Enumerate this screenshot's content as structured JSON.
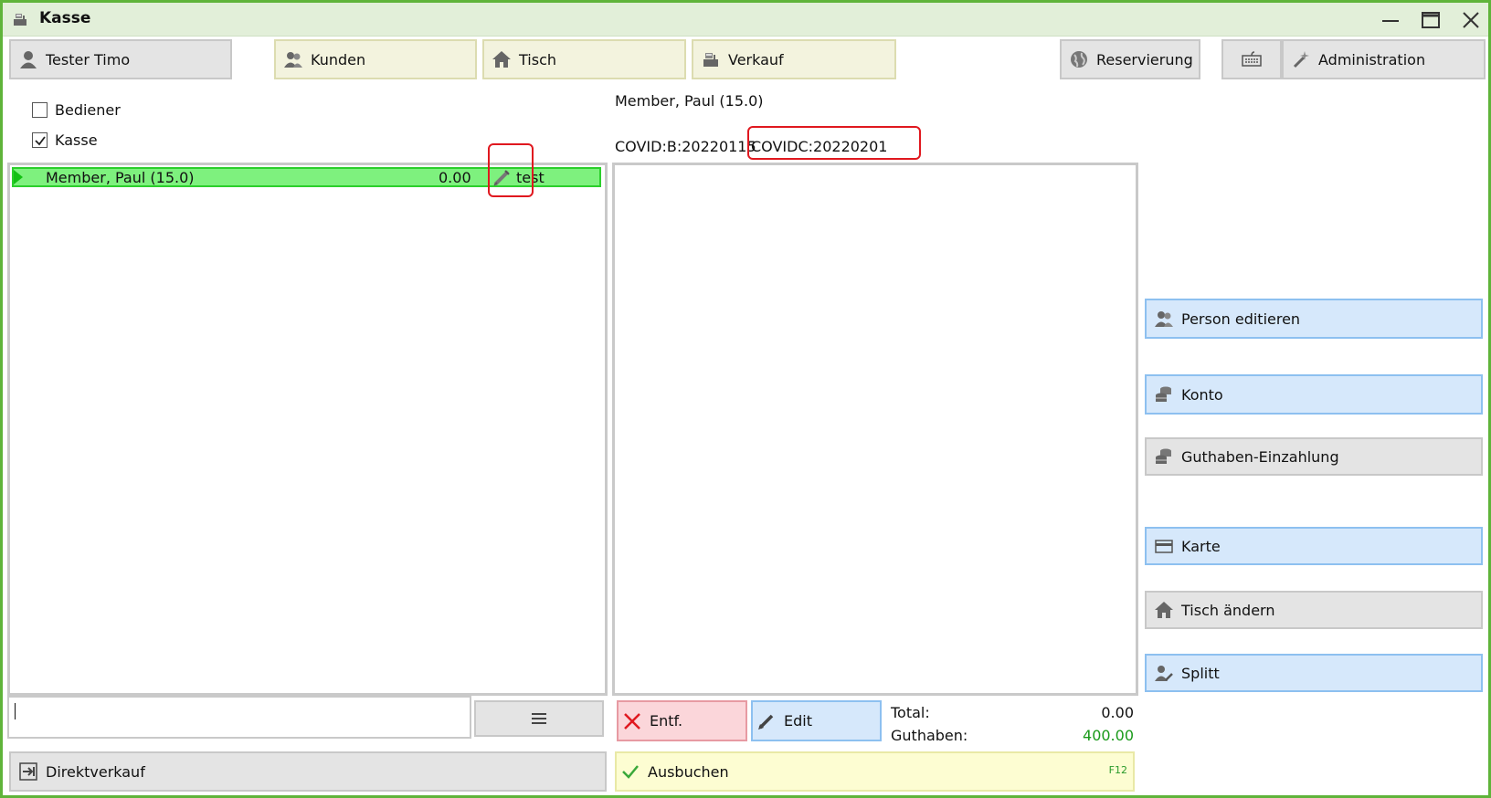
{
  "window": {
    "title": "Kasse",
    "app_icon": "cash-register-icon"
  },
  "toolbar": {
    "user": "Tester Timo",
    "kunden": "Kunden",
    "tisch": "Tisch",
    "verkauf": "Verkauf",
    "reservierung": "Reservierung",
    "administration": "Administration"
  },
  "filters": {
    "bediener": "Bediener",
    "kasse": "Kasse",
    "bediener_checked": false,
    "kasse_checked": true
  },
  "list": {
    "rows": [
      {
        "name": "Member, Paul (15.0)",
        "amount": "0.00",
        "note": "test"
      }
    ]
  },
  "detail": {
    "customer": "Member, Paul (15.0)",
    "covid_b": "COVID:B:20220115",
    "covid_c": "COVIDC:20220201"
  },
  "search": {
    "value": ""
  },
  "menu_button": {
    "icon": "hamburger-icon"
  },
  "actions": {
    "entf": "Entf.",
    "edit": "Edit",
    "direktverkauf": "Direktverkauf",
    "ausbuchen": "Ausbuchen",
    "ausbuchen_shortcut": "F12"
  },
  "totals": {
    "total_label": "Total:",
    "total_value": "0.00",
    "guthaben_label": "Guthaben:",
    "guthaben_value": "400.00"
  },
  "side": {
    "person_editieren": "Person editieren",
    "konto": "Konto",
    "guthaben_einzahlung": "Guthaben-Einzahlung",
    "karte": "Karte",
    "tisch_aendern": "Tisch ändern",
    "splitt": "Splitt"
  },
  "colors": {
    "accent_green": "#5fb43a",
    "row_green": "#7ef17e",
    "positive_value": "#1a9a1a"
  }
}
